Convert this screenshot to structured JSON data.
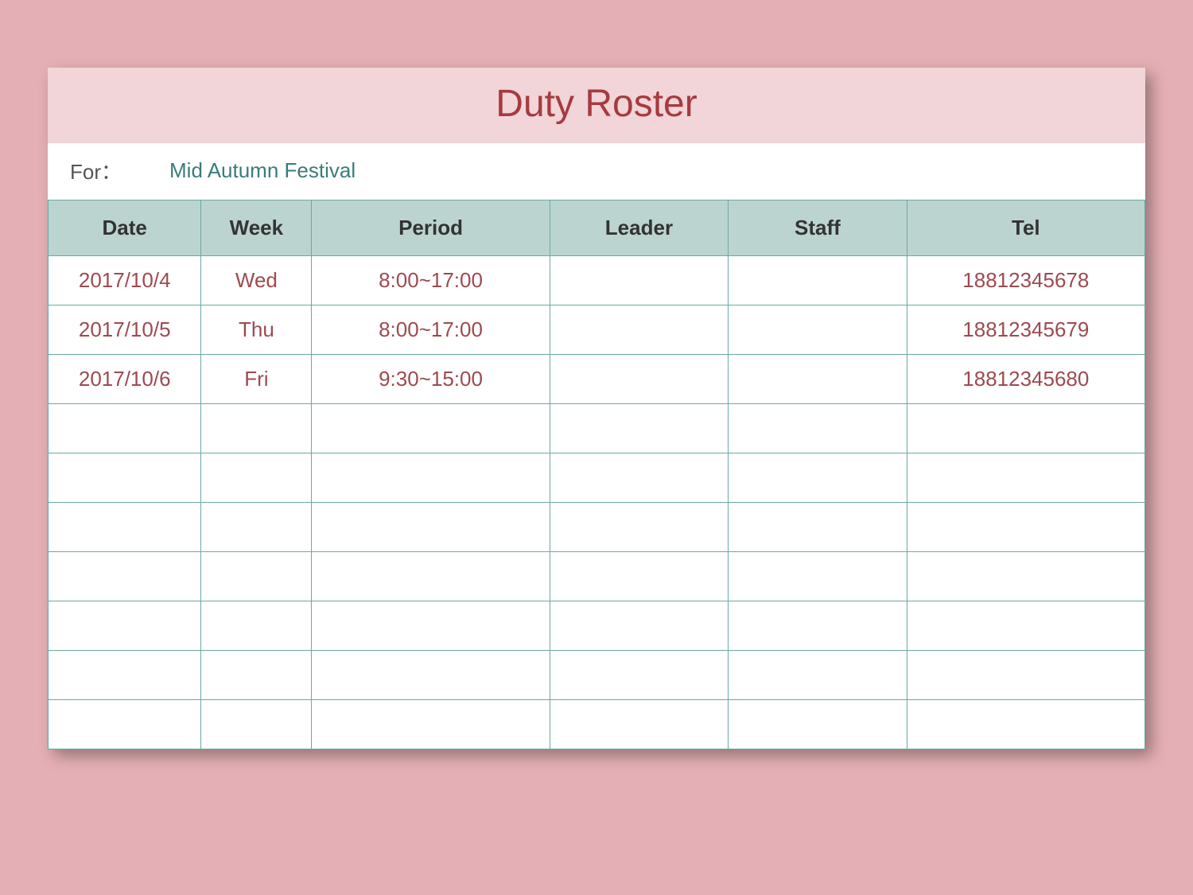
{
  "title": "Duty Roster",
  "for_label": "For：",
  "for_value": "Mid Autumn Festival",
  "columns": [
    "Date",
    "Week",
    "Period",
    "Leader",
    "Staff",
    "Tel"
  ],
  "rows": [
    {
      "date": "2017/10/4",
      "week": "Wed",
      "period": "8:00~17:00",
      "leader": "",
      "staff": "",
      "tel": "18812345678"
    },
    {
      "date": "2017/10/5",
      "week": "Thu",
      "period": "8:00~17:00",
      "leader": "",
      "staff": "",
      "tel": "18812345679"
    },
    {
      "date": "2017/10/6",
      "week": "Fri",
      "period": "9:30~15:00",
      "leader": "",
      "staff": "",
      "tel": "18812345680"
    },
    {
      "date": "",
      "week": "",
      "period": "",
      "leader": "",
      "staff": "",
      "tel": ""
    },
    {
      "date": "",
      "week": "",
      "period": "",
      "leader": "",
      "staff": "",
      "tel": ""
    },
    {
      "date": "",
      "week": "",
      "period": "",
      "leader": "",
      "staff": "",
      "tel": ""
    },
    {
      "date": "",
      "week": "",
      "period": "",
      "leader": "",
      "staff": "",
      "tel": ""
    },
    {
      "date": "",
      "week": "",
      "period": "",
      "leader": "",
      "staff": "",
      "tel": ""
    },
    {
      "date": "",
      "week": "",
      "period": "",
      "leader": "",
      "staff": "",
      "tel": ""
    },
    {
      "date": "",
      "week": "",
      "period": "",
      "leader": "",
      "staff": "",
      "tel": ""
    }
  ],
  "colors": {
    "page_bg": "#e5b0b5",
    "title_bg": "#f1d5d8",
    "title_text": "#a63a3f",
    "header_bg": "#bcd4d0",
    "border": "#6aa9a4",
    "cell_text": "#9e4a4f",
    "for_value_text": "#3b7b7b"
  },
  "chart_data": {
    "type": "table",
    "title": "Duty Roster",
    "subtitle": "Mid Autumn Festival",
    "columns": [
      "Date",
      "Week",
      "Period",
      "Leader",
      "Staff",
      "Tel"
    ],
    "rows": [
      [
        "2017/10/4",
        "Wed",
        "8:00~17:00",
        "",
        "",
        "18812345678"
      ],
      [
        "2017/10/5",
        "Thu",
        "8:00~17:00",
        "",
        "",
        "18812345679"
      ],
      [
        "2017/10/6",
        "Fri",
        "9:30~15:00",
        "",
        "",
        "18812345680"
      ]
    ]
  }
}
